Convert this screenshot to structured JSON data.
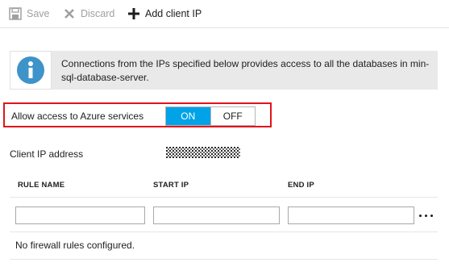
{
  "toolbar": {
    "save_label": "Save",
    "discard_label": "Discard",
    "add_client_ip_label": "Add client IP"
  },
  "info": {
    "icon": "info-icon",
    "message": "Connections from the IPs specified below provides access to all the databases in min-sql-database-server."
  },
  "azure_access": {
    "label": "Allow access to Azure services",
    "on_label": "ON",
    "off_label": "OFF",
    "selected": "ON"
  },
  "client_ip": {
    "label": "Client IP address"
  },
  "rules_table": {
    "columns": [
      "RULE NAME",
      "START IP",
      "END IP"
    ],
    "new_row": {
      "rule_name": "",
      "start_ip": "",
      "end_ip": ""
    },
    "empty_message": "No firewall rules configured."
  },
  "colors": {
    "toggle_on": "#00a2e8",
    "highlight_border": "#e3131b",
    "info_icon": "#3e93c9",
    "info_background": "#e9e9e9"
  }
}
